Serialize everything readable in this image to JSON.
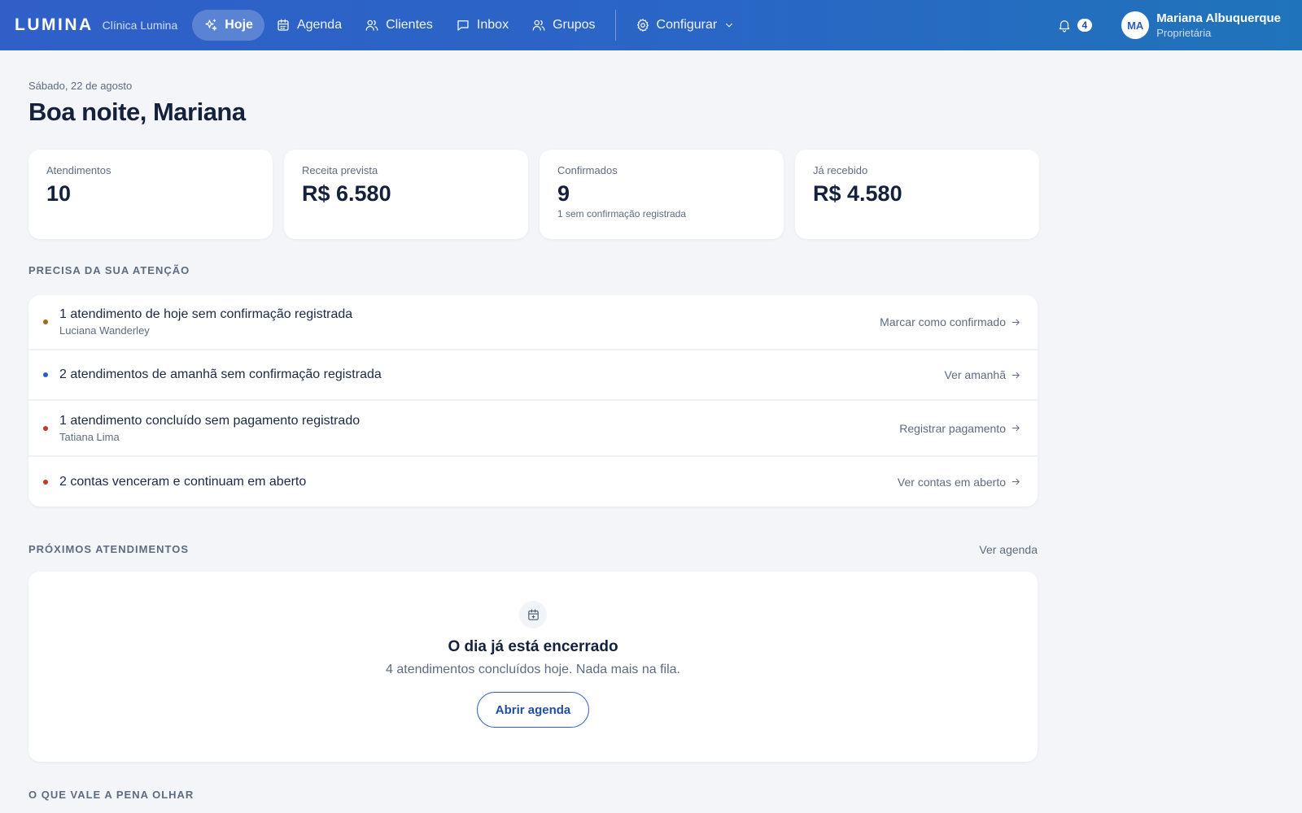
{
  "app": {
    "brand": "LUMINA",
    "clinic": "Clínica Lumina"
  },
  "nav": {
    "items": [
      {
        "label": "Hoje",
        "icon": "sparkles-icon"
      },
      {
        "label": "Agenda",
        "icon": "calendar-icon"
      },
      {
        "label": "Clientes",
        "icon": "users-icon"
      },
      {
        "label": "Inbox",
        "icon": "message-icon"
      },
      {
        "label": "Grupos",
        "icon": "users-icon"
      }
    ],
    "config_label": "Configurar"
  },
  "notifications": {
    "count": "4"
  },
  "user": {
    "initials": "MA",
    "name": "Mariana Albuquerque",
    "role": "Proprietária"
  },
  "page": {
    "date": "Sábado, 22 de agosto",
    "greeting": "Boa noite, Mariana"
  },
  "stats": [
    {
      "label": "Atendimentos",
      "value": "10",
      "sub": ""
    },
    {
      "label": "Receita prevista",
      "value": "R$ 6.580",
      "sub": ""
    },
    {
      "label": "Confirmados",
      "value": "9",
      "sub": "1 sem confirmação registrada"
    },
    {
      "label": "Já recebido",
      "value": "R$ 4.580",
      "sub": ""
    }
  ],
  "attention": {
    "title": "PRECISA DA SUA ATENÇÃO",
    "items": [
      {
        "text": "1 atendimento de hoje sem confirmação registrada",
        "sub": "Luciana Wanderley",
        "action": "Marcar como confirmado",
        "color": "#a8661c"
      },
      {
        "text": "2 atendimentos de amanhã sem confirmação registrada",
        "sub": "",
        "action": "Ver amanhã",
        "color": "#2b5ec4"
      },
      {
        "text": "1 atendimento concluído sem pagamento registrado",
        "sub": "Tatiana Lima",
        "action": "Registrar pagamento",
        "color": "#c0392b"
      },
      {
        "text": "2 contas venceram e continuam em aberto",
        "sub": "",
        "action": "Ver contas em aberto",
        "color": "#c0392b"
      }
    ]
  },
  "upcoming": {
    "title": "PRÓXIMOS ATENDIMENTOS",
    "link": "Ver agenda",
    "empty_title": "O dia já está encerrado",
    "empty_sub": "4 atendimentos concluídos hoje. Nada mais na fila.",
    "button": "Abrir agenda"
  },
  "worth": {
    "title": "O QUE VALE A PENA OLHAR"
  },
  "colors": {
    "accent": "#2b5ec4",
    "topbar_start": "#2f5fc7",
    "topbar_end": "#1f74b9"
  }
}
